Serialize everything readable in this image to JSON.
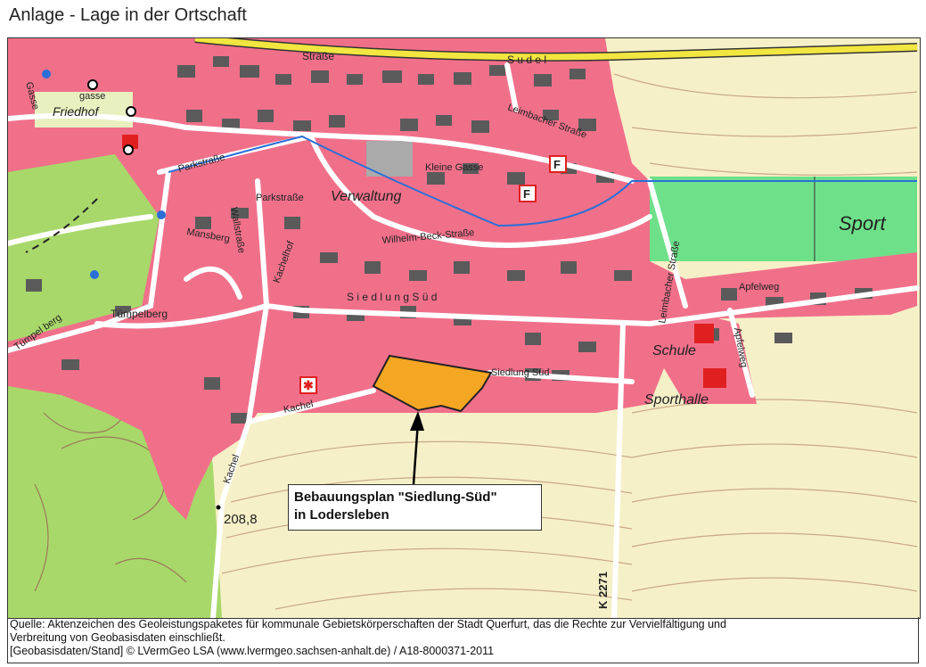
{
  "title": "Anlage - Lage in der Ortschaft",
  "callout": {
    "line1": "Bebauungsplan \"Siedlung-Süd\"",
    "line2": "in Lodersleben"
  },
  "labels": {
    "friedhof": "Friedhof",
    "verwaltung": "Verwaltung",
    "sport": "Sport",
    "schule": "Schule",
    "sporthalle": "Sporthalle",
    "hoehe": "208,8",
    "strasse_top": "Straße",
    "strasse_top2": "S u d e l",
    "parkstrasse1": "Parkstraße",
    "parkstrasse2": "Parkstraße",
    "mansberg": "Mansberg",
    "wallstrasse": "Wallstraße",
    "kachelhof": "Kachelhof",
    "kleine_gasse": "Kleine Gasse",
    "leimbacher1": "Leimbacher Straße",
    "leimbacher2": "Leimbacher Straße",
    "wilhelm": "Wilhelm-Beck-Straße",
    "siedlung_sued1": "S i e d l u n g   S ü d",
    "siedlung_sued2": "Siedlung Süd",
    "tuempelberg": "Tümpelberg",
    "kachel": "Kachel",
    "kachelr": "Kachel",
    "apfelweg1": "Apfelweg",
    "apfelweg2": "Apfelweg",
    "k2271": "K 2271",
    "gasse1": "gasse",
    "gasse2": "Gasse",
    "tuempel_l": "Tümpel berg",
    "feuerwehr": "F"
  },
  "footer": {
    "line1": "Quelle: Aktenzeichen des Geoleistungspaketes für kommunale Gebietskörperschaften der Stadt Querfurt, das die Rechte zur Vervielfältigung und",
    "line2": "Verbreitung von Geobasisdaten einschließt.",
    "line3": "[Geobasisdaten/Stand] © LVermGeo LSA (www.lvermgeo.sachsen-anhalt.de) / A18-8000371-2011"
  },
  "colors": {
    "settlement": "#f0708a",
    "building": "#5a5a5a",
    "field": "#f6f0c8",
    "forest": "#a8d86a",
    "sport": "#6ee08a",
    "plan_area": "#f5a623",
    "main_road": "#f2e640"
  }
}
